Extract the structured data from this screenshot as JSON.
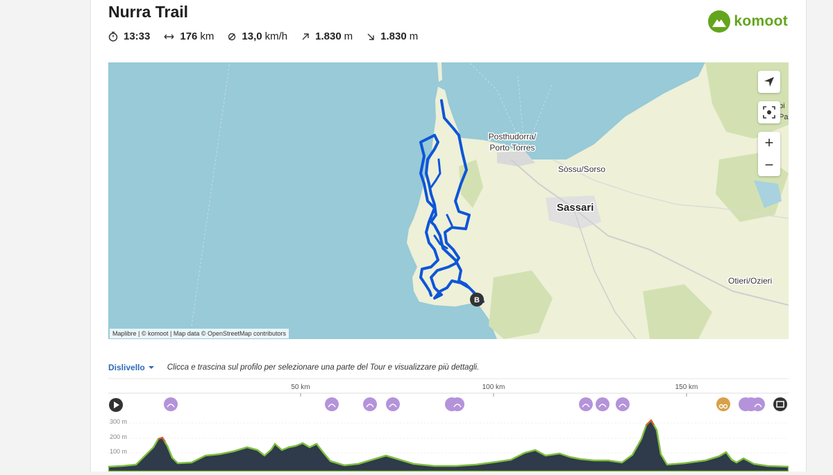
{
  "tour": {
    "title": "Nurra Trail",
    "stats": {
      "duration": "13:33",
      "distance_value": "176",
      "distance_unit": "km",
      "speed_value": "13,0",
      "speed_unit": "km/h",
      "ascent_value": "1.830",
      "ascent_unit": "m",
      "descent_value": "1.830",
      "descent_unit": "m"
    }
  },
  "brand": {
    "name": "komoot",
    "color": "#63a51d"
  },
  "map": {
    "labels": {
      "porto_torres_1": "Posthudorra/",
      "porto_torres_2": "Porto Torres",
      "sorso": "Sòssu/Sorso",
      "sassari": "Sassari",
      "ozieri": "Otieri/Ozieri",
      "edge_1": "pi",
      "edge_2": "Pau"
    },
    "end_marker": "B",
    "attribution": "Maplibre | © komoot | Map data © OpenStreetMap contributors",
    "colors": {
      "sea": "#98cad7",
      "land": "#eef0d8",
      "route": "#0e55d8"
    },
    "controls": [
      "locate-icon",
      "recenter-icon",
      "zoom-in-icon",
      "zoom-out-icon"
    ]
  },
  "profile": {
    "tab_label": "Dislivello",
    "hint": "Clicca e trascina sul profilo per selezionare una parte del Tour e visualizzare più dettagli.",
    "km_ticks": [
      "50 km",
      "100 km",
      "150 km"
    ],
    "elev_ticks": [
      "300 m",
      "200 m",
      "100 m"
    ]
  }
}
